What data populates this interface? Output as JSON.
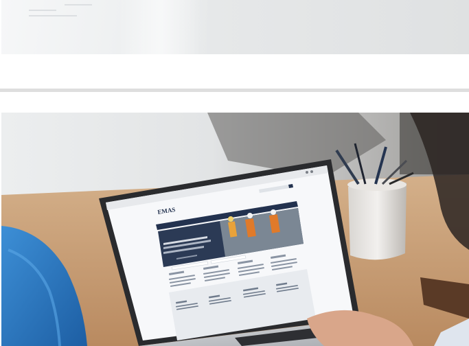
{
  "top_image": {
    "alt_icon": "blurred-office-photo"
  },
  "main_image": {
    "alt_icon": "person-using-laptop-photo",
    "laptop_screen": {
      "site_logo": "EMAS"
    }
  },
  "colors": {
    "divider": "#dedede",
    "site_navy": "#23324f",
    "site_orange": "#e07a2a",
    "desk_wood": "#c99c72"
  }
}
